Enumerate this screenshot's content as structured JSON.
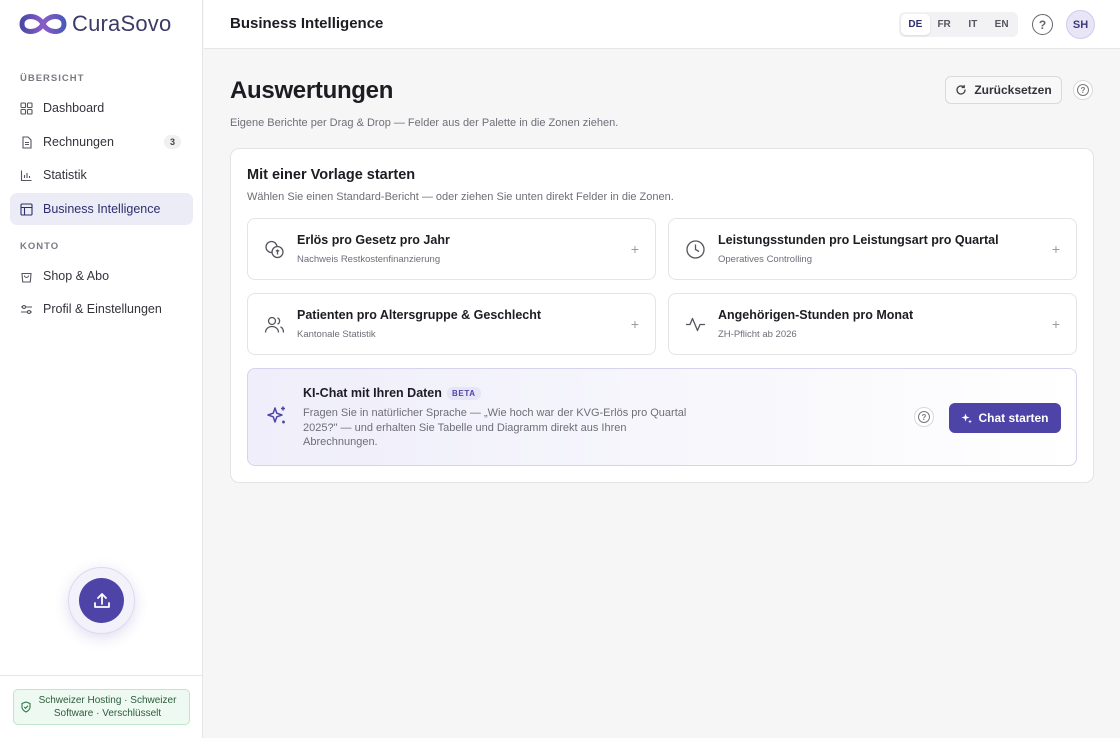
{
  "brand": {
    "name": "CuraSovo",
    "accent": "#4e44a8"
  },
  "sidebar": {
    "section_overview": "ÜBERSICHT",
    "section_account": "KONTO",
    "items": [
      {
        "label": "Dashboard",
        "icon": "grid-icon"
      },
      {
        "label": "Rechnungen",
        "icon": "document-icon",
        "badge": "3"
      },
      {
        "label": "Statistik",
        "icon": "bar-chart-icon"
      },
      {
        "label": "Business Intelligence",
        "icon": "table-layout-icon",
        "active": true
      },
      {
        "label": "Shop & Abo",
        "icon": "shopping-bag-icon"
      },
      {
        "label": "Profil & Einstellungen",
        "icon": "sliders-icon"
      }
    ],
    "upload_icon": "upload-icon",
    "trust_badge": "Schweizer Hosting · Schweizer Software · Verschlüsselt"
  },
  "topbar": {
    "title": "Business Intelligence",
    "languages": [
      "DE",
      "FR",
      "IT",
      "EN"
    ],
    "active_language": "DE",
    "avatar_initials": "SH"
  },
  "main": {
    "title": "Auswertungen",
    "subtitle": "Eigene Berichte per Drag & Drop — Felder aus der Palette in die Zonen ziehen.",
    "reset_label": "Zurücksetzen",
    "templates_panel": {
      "title": "Mit einer Vorlage starten",
      "subtitle": "Wählen Sie einen Standard-Bericht — oder ziehen Sie unten direkt Felder in die Zonen.",
      "templates": [
        {
          "title": "Erlös pro Gesetz pro Jahr",
          "subtitle": "Nachweis Restkostenfinanzierung",
          "icon": "coins-icon"
        },
        {
          "title": "Leistungsstunden pro Leistungsart pro Quartal",
          "subtitle": "Operatives Controlling",
          "icon": "clock-icon"
        },
        {
          "title": "Patienten pro Altersgruppe & Geschlecht",
          "subtitle": "Kantonale Statistik",
          "icon": "users-icon"
        },
        {
          "title": "Angehörigen-Stunden pro Monat",
          "subtitle": "ZH-Pflicht ab 2026",
          "icon": "activity-icon"
        }
      ],
      "plus": "+"
    },
    "ai_chat": {
      "title": "KI-Chat mit Ihren Daten",
      "badge": "BETA",
      "description": "Fragen Sie in natürlicher Sprache — „Wie hoch war der KVG-Erlös pro Quartal 2025?\" — und erhalten Sie Tabelle und Diagramm direkt aus Ihren Abrechnungen.",
      "button_label": "Chat starten"
    }
  }
}
